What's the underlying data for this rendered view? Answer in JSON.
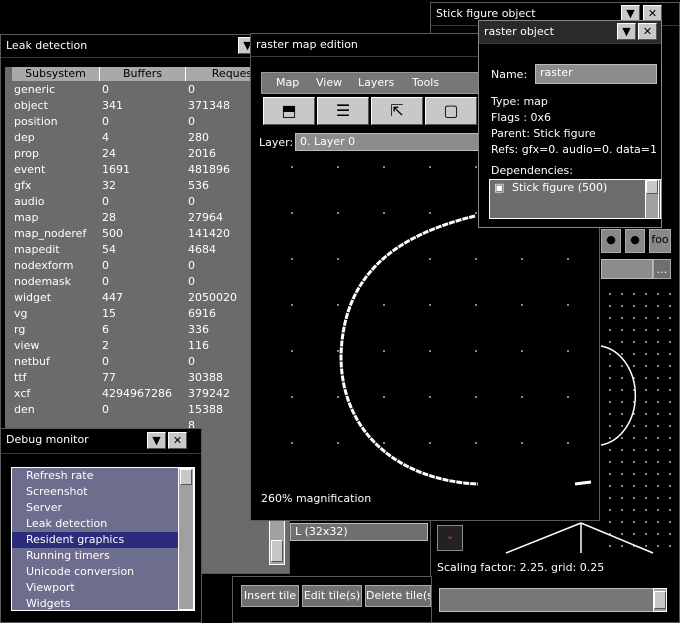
{
  "leak": {
    "title": "Leak detection",
    "headers": [
      "Subsystem",
      "Buffers",
      "Requests"
    ],
    "rows": [
      [
        "generic",
        "0",
        "0"
      ],
      [
        "object",
        "341",
        "371348"
      ],
      [
        "position",
        "0",
        "0"
      ],
      [
        "dep",
        "4",
        "280"
      ],
      [
        "prop",
        "24",
        "2016"
      ],
      [
        "event",
        "1691",
        "481896"
      ],
      [
        "gfx",
        "32",
        "536"
      ],
      [
        "audio",
        "0",
        "0"
      ],
      [
        "map",
        "28",
        "27964"
      ],
      [
        "map_noderef",
        "500",
        "141420"
      ],
      [
        "mapedit",
        "54",
        "4684"
      ],
      [
        "nodexform",
        "0",
        "0"
      ],
      [
        "nodemask",
        "0",
        "0"
      ],
      [
        "widget",
        "447",
        "2050020"
      ],
      [
        "vg",
        "15",
        "6916"
      ],
      [
        "rg",
        "6",
        "336"
      ],
      [
        "view",
        "2",
        "116"
      ],
      [
        "netbuf",
        "0",
        "0"
      ],
      [
        "ttf",
        "77",
        "30388"
      ],
      [
        "xcf",
        "4294967286",
        "379242"
      ],
      [
        "den",
        "0",
        "15388"
      ],
      [
        "",
        "",
        "8"
      ]
    ]
  },
  "debug": {
    "title": "Debug monitor",
    "items": [
      "Refresh rate",
      "Screenshot",
      "Server",
      "Leak detection",
      "Resident graphics",
      "Running timers",
      "Unicode conversion",
      "Viewport",
      "Widgets"
    ],
    "selected_index": 4
  },
  "raster": {
    "title": "raster map edition",
    "menu": [
      "Map",
      "View",
      "Layers",
      "Tools"
    ],
    "layer_label": "Layer:",
    "layer_value": "0. Layer 0",
    "magnification": "260% magnification"
  },
  "stick": {
    "title": "Stick figure object",
    "scaling": "Scaling factor: 2.25. grid: 0.25",
    "tile_label": "L (32x32)",
    "buttons": [
      "Insert tile",
      "Edit tile(s)",
      "Delete tile(s)"
    ],
    "icon_btn_label": "foo",
    "field_btn": "..."
  },
  "robj": {
    "title": "raster object",
    "name_label": "Name:",
    "name_value": "raster",
    "type_line": "Type: map",
    "flags_line": "Flags : 0x6",
    "parent_line": "Parent: Stick figure",
    "refs_line": "Refs: gfx=0. audio=0. data=1",
    "deps_label": "Dependencies:",
    "dep_item": "Stick figure (500)"
  },
  "icons": {
    "minimize": "chevron-down-icon",
    "close": "close-icon"
  }
}
